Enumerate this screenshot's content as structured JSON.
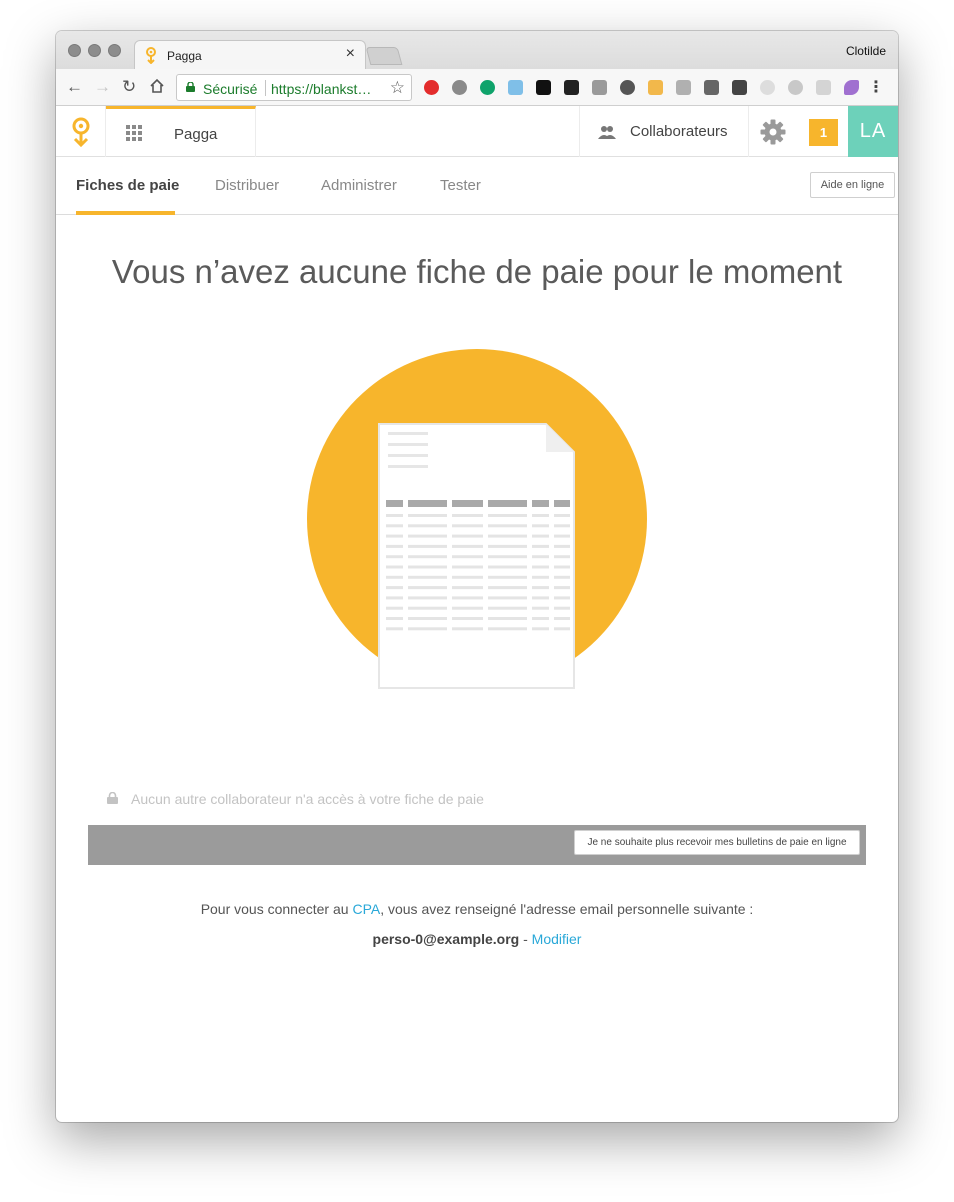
{
  "browser": {
    "tab_title": "Pagga",
    "profile": "Clotilde",
    "secure_label": "Sécurisé",
    "url": "https://blankst…"
  },
  "app": {
    "name": "Pagga",
    "collaborators_label": "Collaborateurs",
    "notifications_count": "1",
    "avatar_initials": "LA",
    "brand_color": "#f7b52c",
    "avatar_color": "#6dd1ba"
  },
  "subnav": {
    "tabs": [
      {
        "label": "Fiches de paie",
        "active": true
      },
      {
        "label": "Distribuer",
        "active": false
      },
      {
        "label": "Administrer",
        "active": false
      },
      {
        "label": "Tester",
        "active": false
      }
    ],
    "help_label": "Aide en ligne"
  },
  "main": {
    "headline": "Vous n’avez aucune fiche de paie pour le moment",
    "privacy_note": "Aucun autre collaborateur n'a accès à votre fiche de paie",
    "unsubscribe_label": "Je ne souhaite plus recevoir mes bulletins de paie en ligne",
    "info_prefix": "Pour vous connecter au ",
    "info_link": "CPA",
    "info_suffix": ", vous avez renseigné l'adresse email personnelle suivante :",
    "email": "perso-0@example.org",
    "email_sep": " - ",
    "modify_label": "Modifier"
  }
}
